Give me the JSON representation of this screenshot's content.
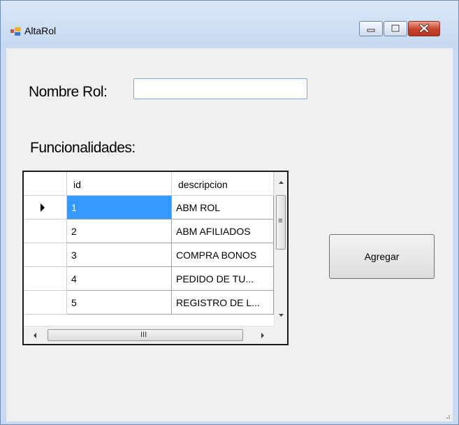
{
  "window": {
    "title": "AltaRol"
  },
  "controls": {
    "minimize": "minimize",
    "maximize": "maximize",
    "close": "close"
  },
  "form": {
    "nombre_label": "Nombre Rol:",
    "nombre_value": "",
    "funcionalidades_label": "Funcionalidades:",
    "agregar_label": "Agregar"
  },
  "grid": {
    "columns": [
      "id",
      "descripcion"
    ],
    "rows": [
      {
        "id": "1",
        "descripcion": "ABM ROL",
        "selected": true
      },
      {
        "id": "2",
        "descripcion": "ABM AFILIADOS"
      },
      {
        "id": "3",
        "descripcion": "COMPRA BONOS"
      },
      {
        "id": "4",
        "descripcion": "PEDIDO DE TU..."
      },
      {
        "id": "5",
        "descripcion": "REGISTRO DE L..."
      }
    ],
    "hscroll_glyph": "III",
    "vscroll_glyph": "≡"
  },
  "colors": {
    "selection": "#3399ff",
    "title_bar": "#c6d9f1",
    "close_button": "#c7432b"
  }
}
